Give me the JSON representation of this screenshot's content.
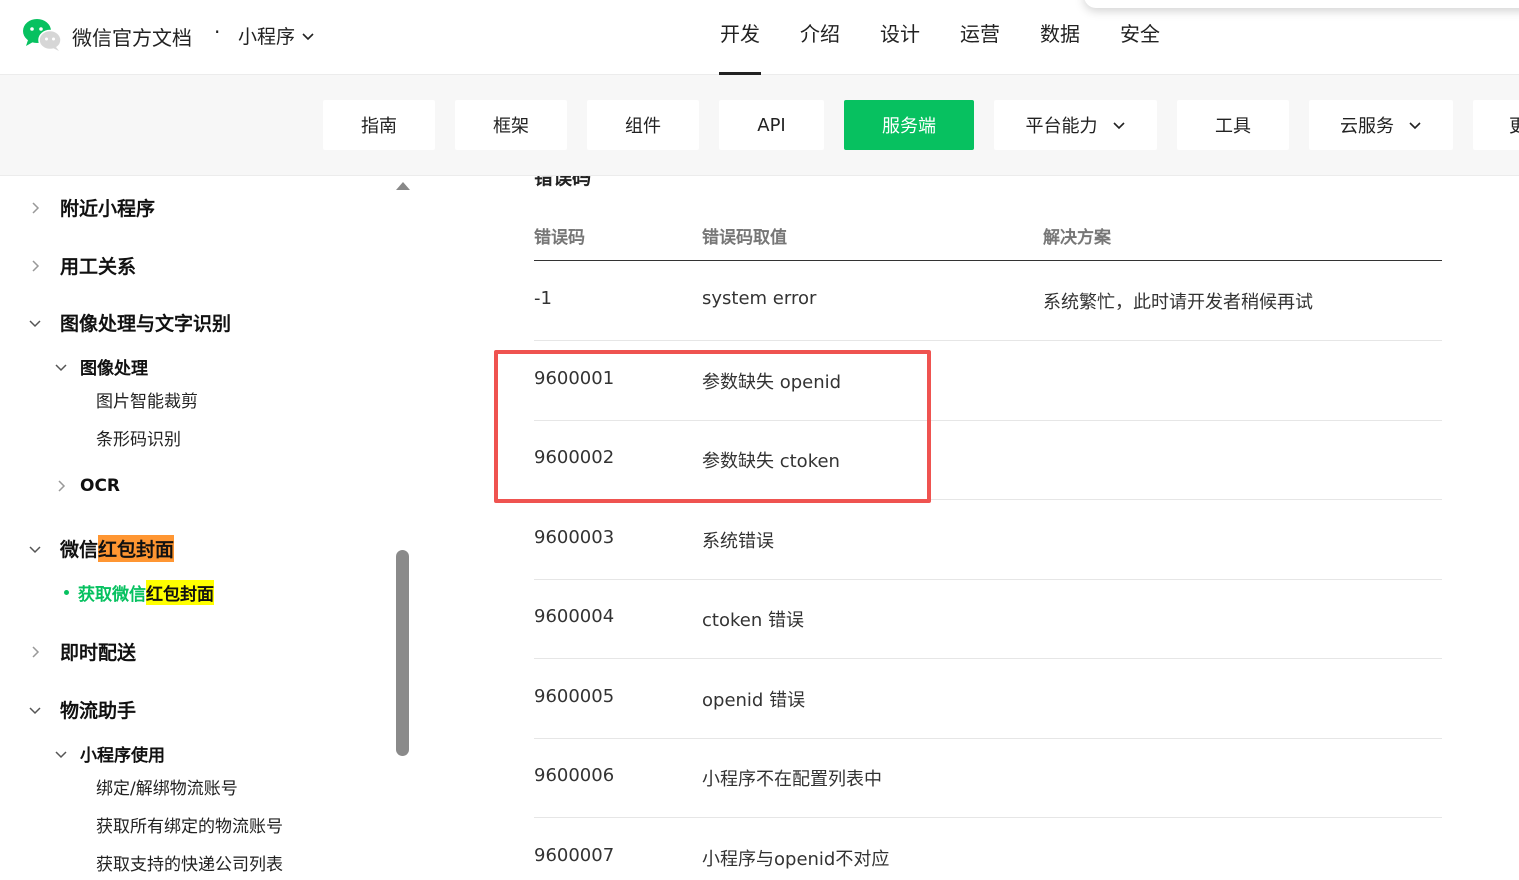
{
  "header": {
    "site_title": "微信官方文档",
    "separator": "·",
    "section": "小程序",
    "nav": [
      "开发",
      "介绍",
      "设计",
      "运营",
      "数据",
      "安全"
    ],
    "active_nav": "开发"
  },
  "subnav": {
    "items": [
      {
        "label": "指南"
      },
      {
        "label": "框架"
      },
      {
        "label": "组件"
      },
      {
        "label": "API"
      },
      {
        "label": "服务端",
        "active": true
      },
      {
        "label": "平台能力",
        "dropdown": true
      },
      {
        "label": "工具"
      },
      {
        "label": "云服务",
        "dropdown": true
      },
      {
        "label": "更"
      }
    ]
  },
  "sidebar": {
    "items": [
      {
        "label": "附近小程序",
        "state": "collapsed"
      },
      {
        "label": "用工关系",
        "state": "collapsed"
      },
      {
        "label": "图像处理与文字识别",
        "state": "expanded"
      },
      {
        "label": "图像处理",
        "state": "expanded"
      },
      {
        "label": "图片智能裁剪"
      },
      {
        "label": "条形码识别"
      },
      {
        "label": "OCR",
        "state": "collapsed"
      },
      {
        "label_plain": "微信",
        "label_highlight": "红包封面",
        "state": "expanded"
      },
      {
        "label_plain": "获取微信",
        "label_highlight": "红包封面",
        "current": true
      },
      {
        "label": "即时配送",
        "state": "collapsed"
      },
      {
        "label": "物流助手",
        "state": "expanded"
      },
      {
        "label": "小程序使用",
        "state": "expanded"
      },
      {
        "label": "绑定/解绑物流账号"
      },
      {
        "label": "获取所有绑定的物流账号"
      },
      {
        "label": "获取支持的快递公司列表"
      }
    ]
  },
  "content": {
    "section_heading": "错误码",
    "columns": [
      "错误码",
      "错误码取值",
      "解决方案"
    ],
    "rows": [
      [
        "-1",
        "system error",
        "系统繁忙，此时请开发者稍候再试"
      ],
      [
        "9600001",
        "参数缺失 openid",
        ""
      ],
      [
        "9600002",
        "参数缺失 ctoken",
        ""
      ],
      [
        "9600003",
        "系统错误",
        ""
      ],
      [
        "9600004",
        "ctoken 错误",
        ""
      ],
      [
        "9600005",
        "openid 错误",
        ""
      ],
      [
        "9600006",
        "小程序不在配置列表中",
        ""
      ],
      [
        "9600007",
        "小程序与openid不对应",
        ""
      ]
    ],
    "highlight_box_color": "#ef5350"
  },
  "colors": {
    "brand_green": "#07c160",
    "highlight_orange": "#ff9632",
    "highlight_yellow": "#ffff00"
  }
}
